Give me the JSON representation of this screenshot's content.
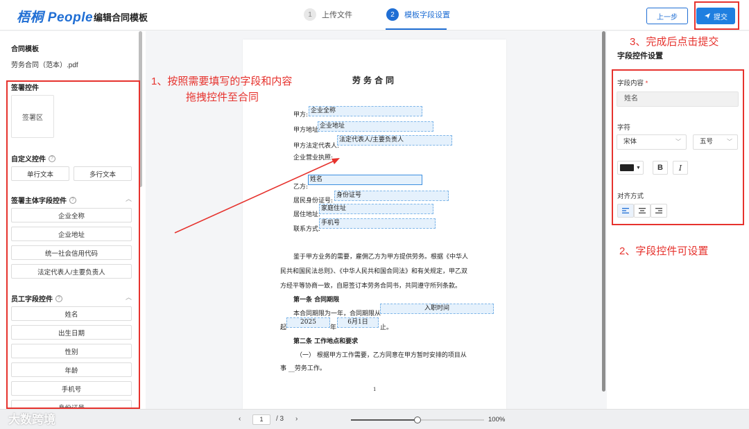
{
  "header": {
    "logo": "梧桐 People",
    "page_title": "编辑合同模板",
    "steps": [
      {
        "num": "1",
        "label": "上传文件"
      },
      {
        "num": "2",
        "label": "模板字段设置"
      }
    ],
    "prev_label": "上一步",
    "submit_label": "提交"
  },
  "annotations": {
    "a1_line1": "1、按照需要填写的字段和内容",
    "a1_line2": "拖拽控件至合同",
    "a2": "2、字段控件可设置",
    "a3": "3、完成后点击提交"
  },
  "left": {
    "template_title": "合同模板",
    "file_name": "劳务合同（范本）.pdf",
    "sign_title": "签署控件",
    "sign_area": "签署区",
    "custom_title": "自定义控件",
    "custom_items": [
      "单行文本",
      "多行文本"
    ],
    "subject_title": "签署主体字段控件",
    "subject_items": [
      "企业全称",
      "企业地址",
      "统一社会信用代码",
      "法定代表人/主要负责人"
    ],
    "employee_title": "员工字段控件",
    "employee_items": [
      "姓名",
      "出生日期",
      "性别",
      "年龄",
      "手机号",
      "身份证号"
    ]
  },
  "doc": {
    "title": "劳务合同",
    "party_a": "甲方:",
    "party_a_field": "企业全称",
    "addr_a": "甲方地址:",
    "addr_a_field": "企业地址",
    "legal_rep": "甲方法定代表人:",
    "legal_rep_field": "法定代表人/主要负责人",
    "license": "企业营业执照:",
    "party_b": "乙方:",
    "party_b_field": "姓名",
    "id_no": "居民身份证号:",
    "id_no_field": "身份证号",
    "home_addr": "居住地址:",
    "home_addr_field": "家庭住址",
    "contact": "联系方式:",
    "contact_field": "手机号",
    "para1_l1": "鉴于甲方业务的需要，雇佣乙方为甲方提供劳务。根据《中华人",
    "para1_l2": "民共和国民法总则》、《中华人民共和国合同法》和有关规定，甲乙双",
    "para1_l3": "方经平等协商一致，自愿签订本劳务合同书，共同遵守所列条款。",
    "art1_title": "第一条 合同期限",
    "art1_l1": "本合同期限为一年，合同期限从",
    "art1_field_entry": "入职时间",
    "art1_l2_start": "起",
    "art1_year": "2025",
    "art1_year_suffix": "年",
    "art1_date": "6月1日",
    "art1_l2_end": "止。",
    "art2_title": "第二条 工作地点和要求",
    "art2_l1": "（一） 根据甲方工作需要，乙方同意在甲方暂时安排的项目从",
    "art2_l2": "事 __劳务工作。",
    "page_no": "1"
  },
  "right": {
    "title": "字段控件设置",
    "content_label": "字段内容",
    "required_mark": "*",
    "content_value": "姓名",
    "font_label": "字符",
    "font_family": "宋体",
    "font_size": "五号",
    "bold": "B",
    "italic": "I",
    "align_label": "对齐方式"
  },
  "bottom": {
    "page_current": "1",
    "page_total": "/ 3",
    "zoom": "100%",
    "zoom_fraction": 0.5
  },
  "watermark": "大数跨境",
  "colors": {
    "brand": "#1f6ed4",
    "annotation": "#e6322d"
  }
}
